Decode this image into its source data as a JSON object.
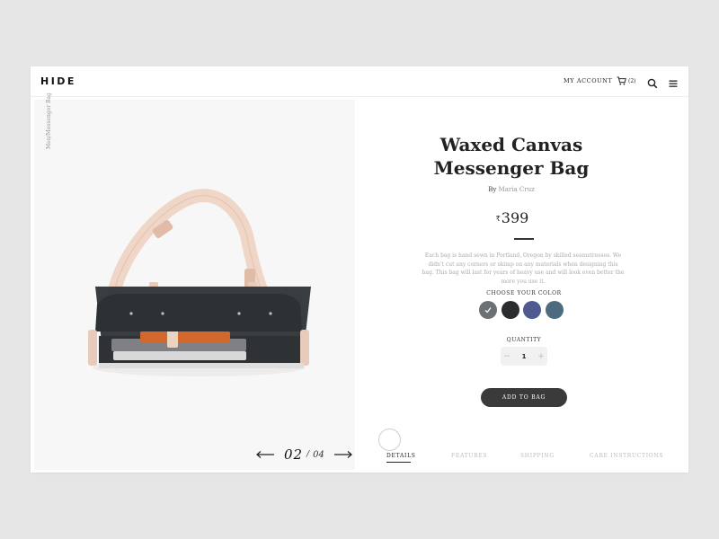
{
  "header": {
    "logo": "HIDE",
    "account_label": "MY ACCOUNT",
    "cart_count": "(2)",
    "icons": [
      "cart-icon",
      "search-icon",
      "menu-icon"
    ]
  },
  "gallery": {
    "vertical_label": "Men/Messenger Bag",
    "current_page": "02",
    "separator": "/",
    "total_pages": "04",
    "icons": [
      "arrow-left-icon",
      "arrow-right-icon"
    ]
  },
  "product": {
    "title_line1": "Waxed Canvas",
    "title_line2": "Messenger Bag",
    "by_prefix": "By",
    "author": "Maria Cruz",
    "currency": "₹",
    "price": "399",
    "description": "Each bag is hand sewn in Portland, Oregon by skilled seamstresses. We didn't cut any corners or skimp on any materials when designing this bag. This bag will last for years of heavy use and will look even better the more you use it."
  },
  "color_picker": {
    "label": "CHOOSE YOUR COLOR",
    "colors": [
      "#6b7074",
      "#2b2c2e",
      "#4f5a8f",
      "#4d6a7e"
    ],
    "selected_index": 0
  },
  "quantity": {
    "label": "QUANTITY",
    "minus": "−",
    "value": "1",
    "plus": "+"
  },
  "cta": {
    "add_to_bag": "ADD TO BAG"
  },
  "tabs": {
    "details": "DETAILS",
    "features": "FEATURES",
    "shipping": "SHIPPING",
    "care": "CARE INSTRUCTIONS",
    "active": "details"
  },
  "colors": {
    "page_bg": "#e6e6e6",
    "card_bg": "#ffffff",
    "text_dark": "#222222",
    "text_muted": "#aaaaaa",
    "button_bg": "#3a3a3a"
  }
}
